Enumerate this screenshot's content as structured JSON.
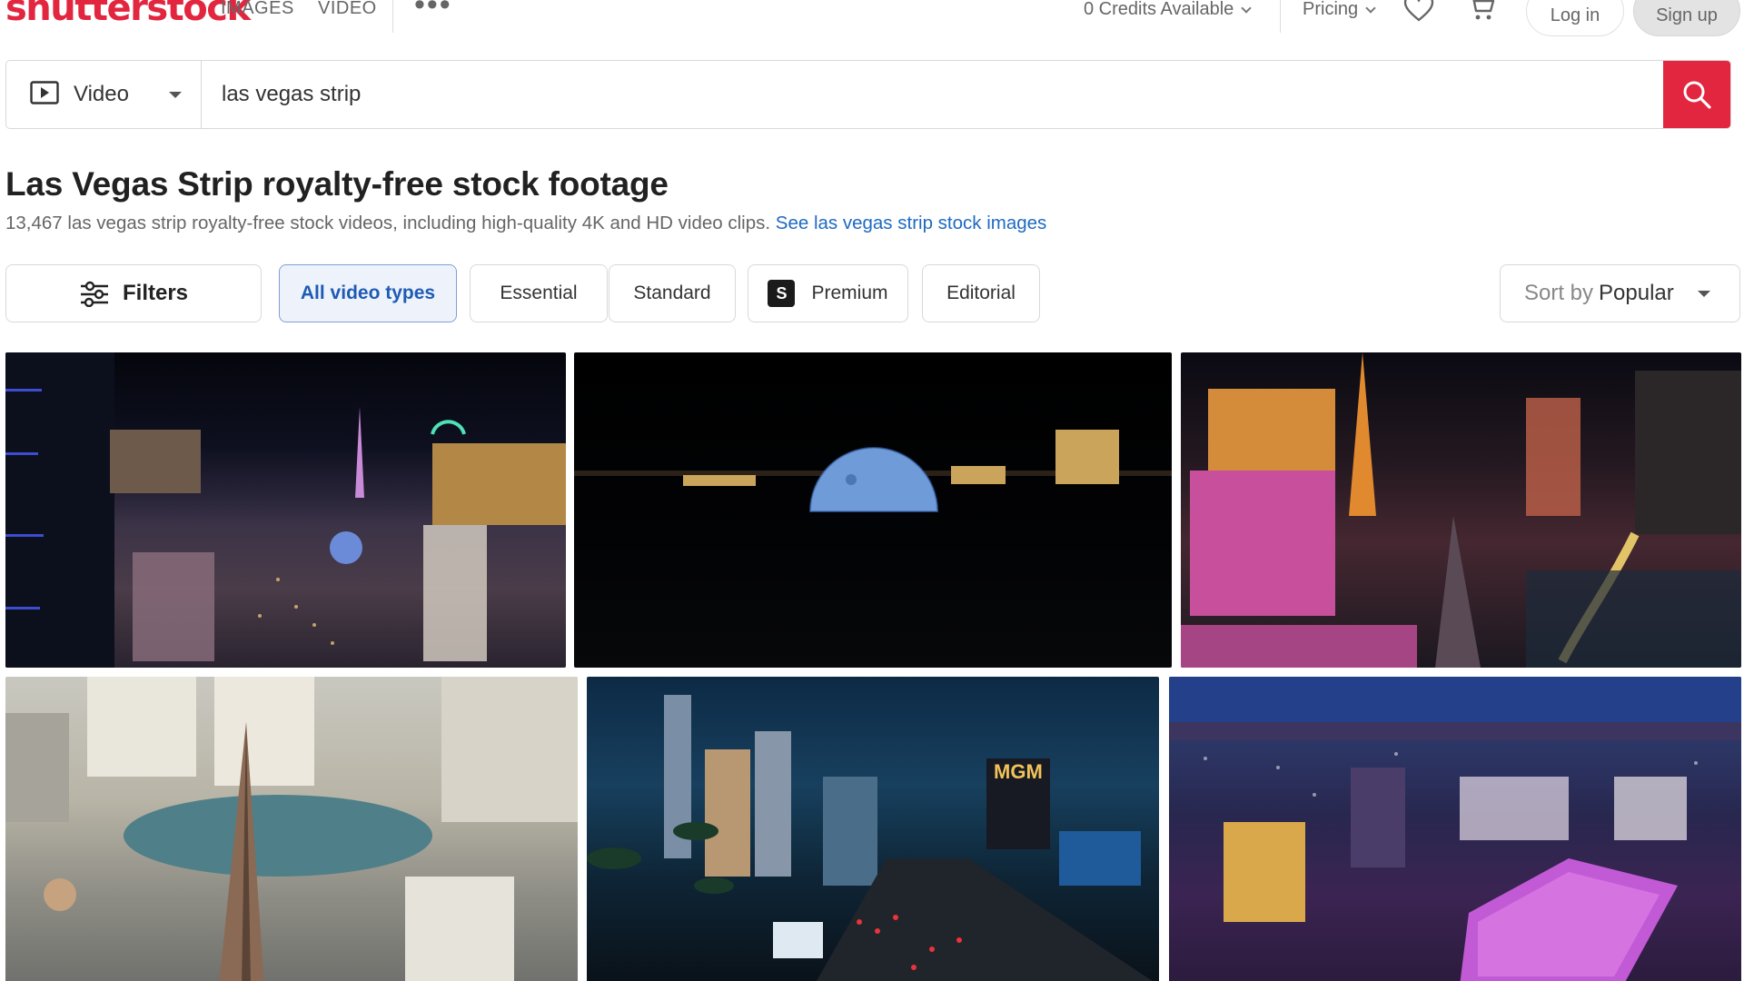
{
  "header": {
    "logo": "shutterstock",
    "nav": [
      {
        "label": "IMAGES"
      },
      {
        "label": "VIDEO"
      }
    ],
    "credits": "0 Credits Available",
    "pricing": "Pricing",
    "login": "Log in",
    "signup": "Sign up"
  },
  "search": {
    "media_type": "Video",
    "query": "las vegas strip"
  },
  "results": {
    "title": "Las Vegas Strip royalty-free stock footage",
    "summary": "13,467 las vegas strip royalty-free stock videos, including high-quality 4K and HD video clips.",
    "image_link": "See las vegas strip stock images"
  },
  "filters": {
    "filters_label": "Filters",
    "chips": [
      {
        "label": "All video types",
        "selected": true
      },
      {
        "label": "Essential"
      },
      {
        "label": "Standard"
      },
      {
        "label": "Premium",
        "badge": "S"
      },
      {
        "label": "Editorial"
      }
    ],
    "sort_prefix": "Sort by",
    "sort_value": "Popular"
  },
  "colors": {
    "brand": "#e2263f",
    "link": "#1e6ac2",
    "selected_chip_bg": "#eef3fb",
    "selected_chip_text": "#1e5bb5"
  },
  "icons": [
    "more-icon",
    "chevron-down-icon",
    "heart-icon",
    "cart-icon",
    "video-icon",
    "search-icon",
    "filters-icon",
    "caret-down-icon"
  ]
}
